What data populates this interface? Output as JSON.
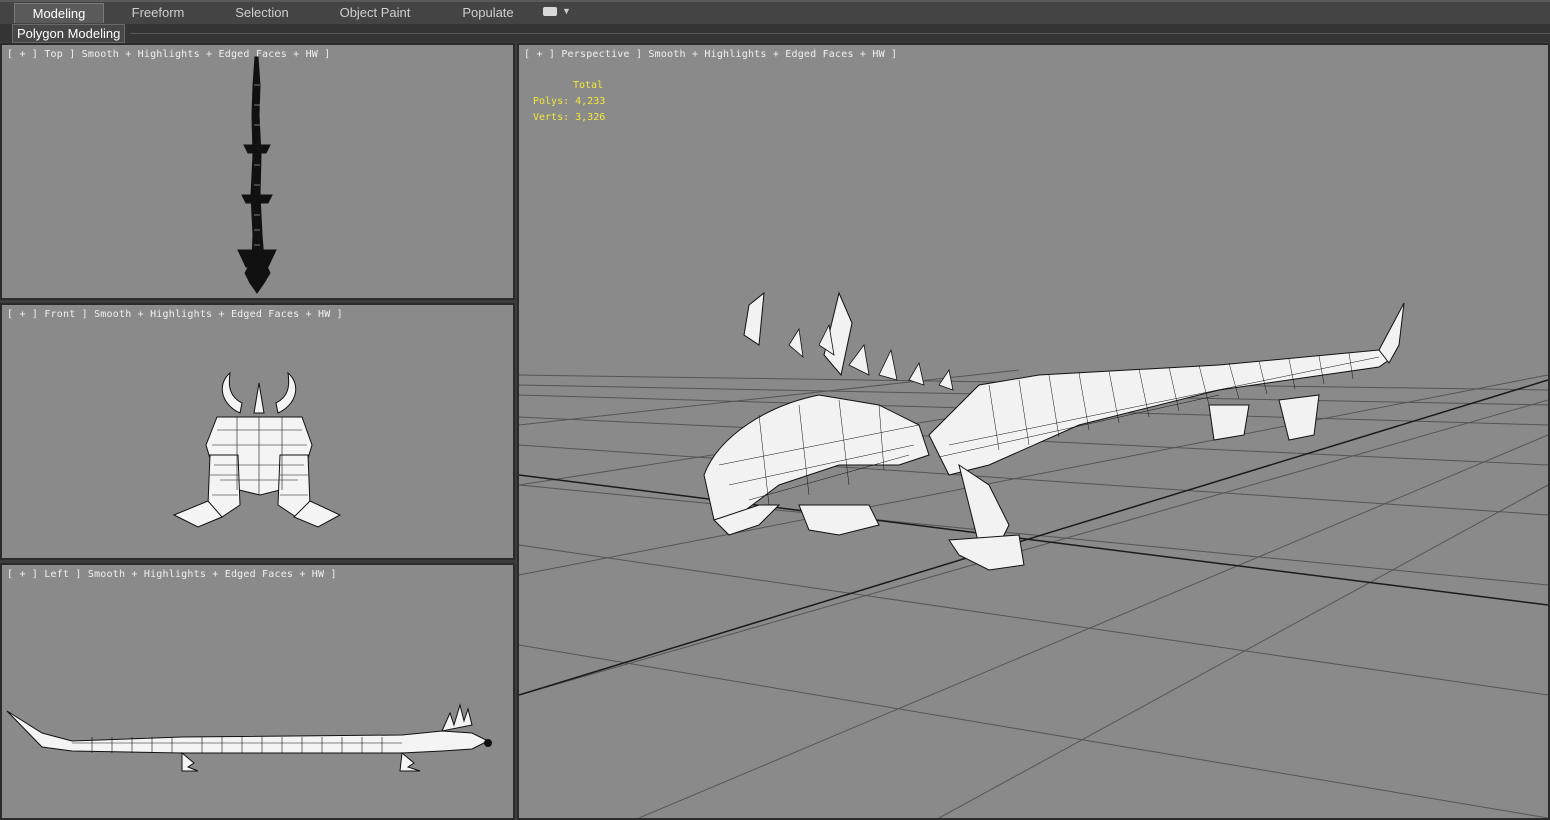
{
  "ribbon": {
    "tabs": [
      {
        "label": "Modeling",
        "active": true
      },
      {
        "label": "Freeform",
        "active": false
      },
      {
        "label": "Selection",
        "active": false
      },
      {
        "label": "Object Paint",
        "active": false
      },
      {
        "label": "Populate",
        "active": false
      }
    ],
    "panel_label": "Polygon Modeling"
  },
  "viewports": {
    "top": {
      "label": "[ + ] Top ] Smooth + Highlights + Edged Faces + HW ]"
    },
    "front": {
      "label": "[ + ] Front ] Smooth + Highlights + Edged Faces + HW ]"
    },
    "left": {
      "label": "[ + ] Left ] Smooth + Highlights + Edged Faces + HW ]"
    },
    "perspective": {
      "label": "[ + ] Perspective ] Smooth + Highlights + Edged Faces + HW ]",
      "stats": {
        "header": "Total",
        "polys": "Polys: 4,233",
        "verts": "Verts: 3,326"
      }
    }
  },
  "colors": {
    "viewport_bg": "#8a8a8a",
    "stats_text": "#f2e83a",
    "ui_dark": "#3c3c3c"
  }
}
